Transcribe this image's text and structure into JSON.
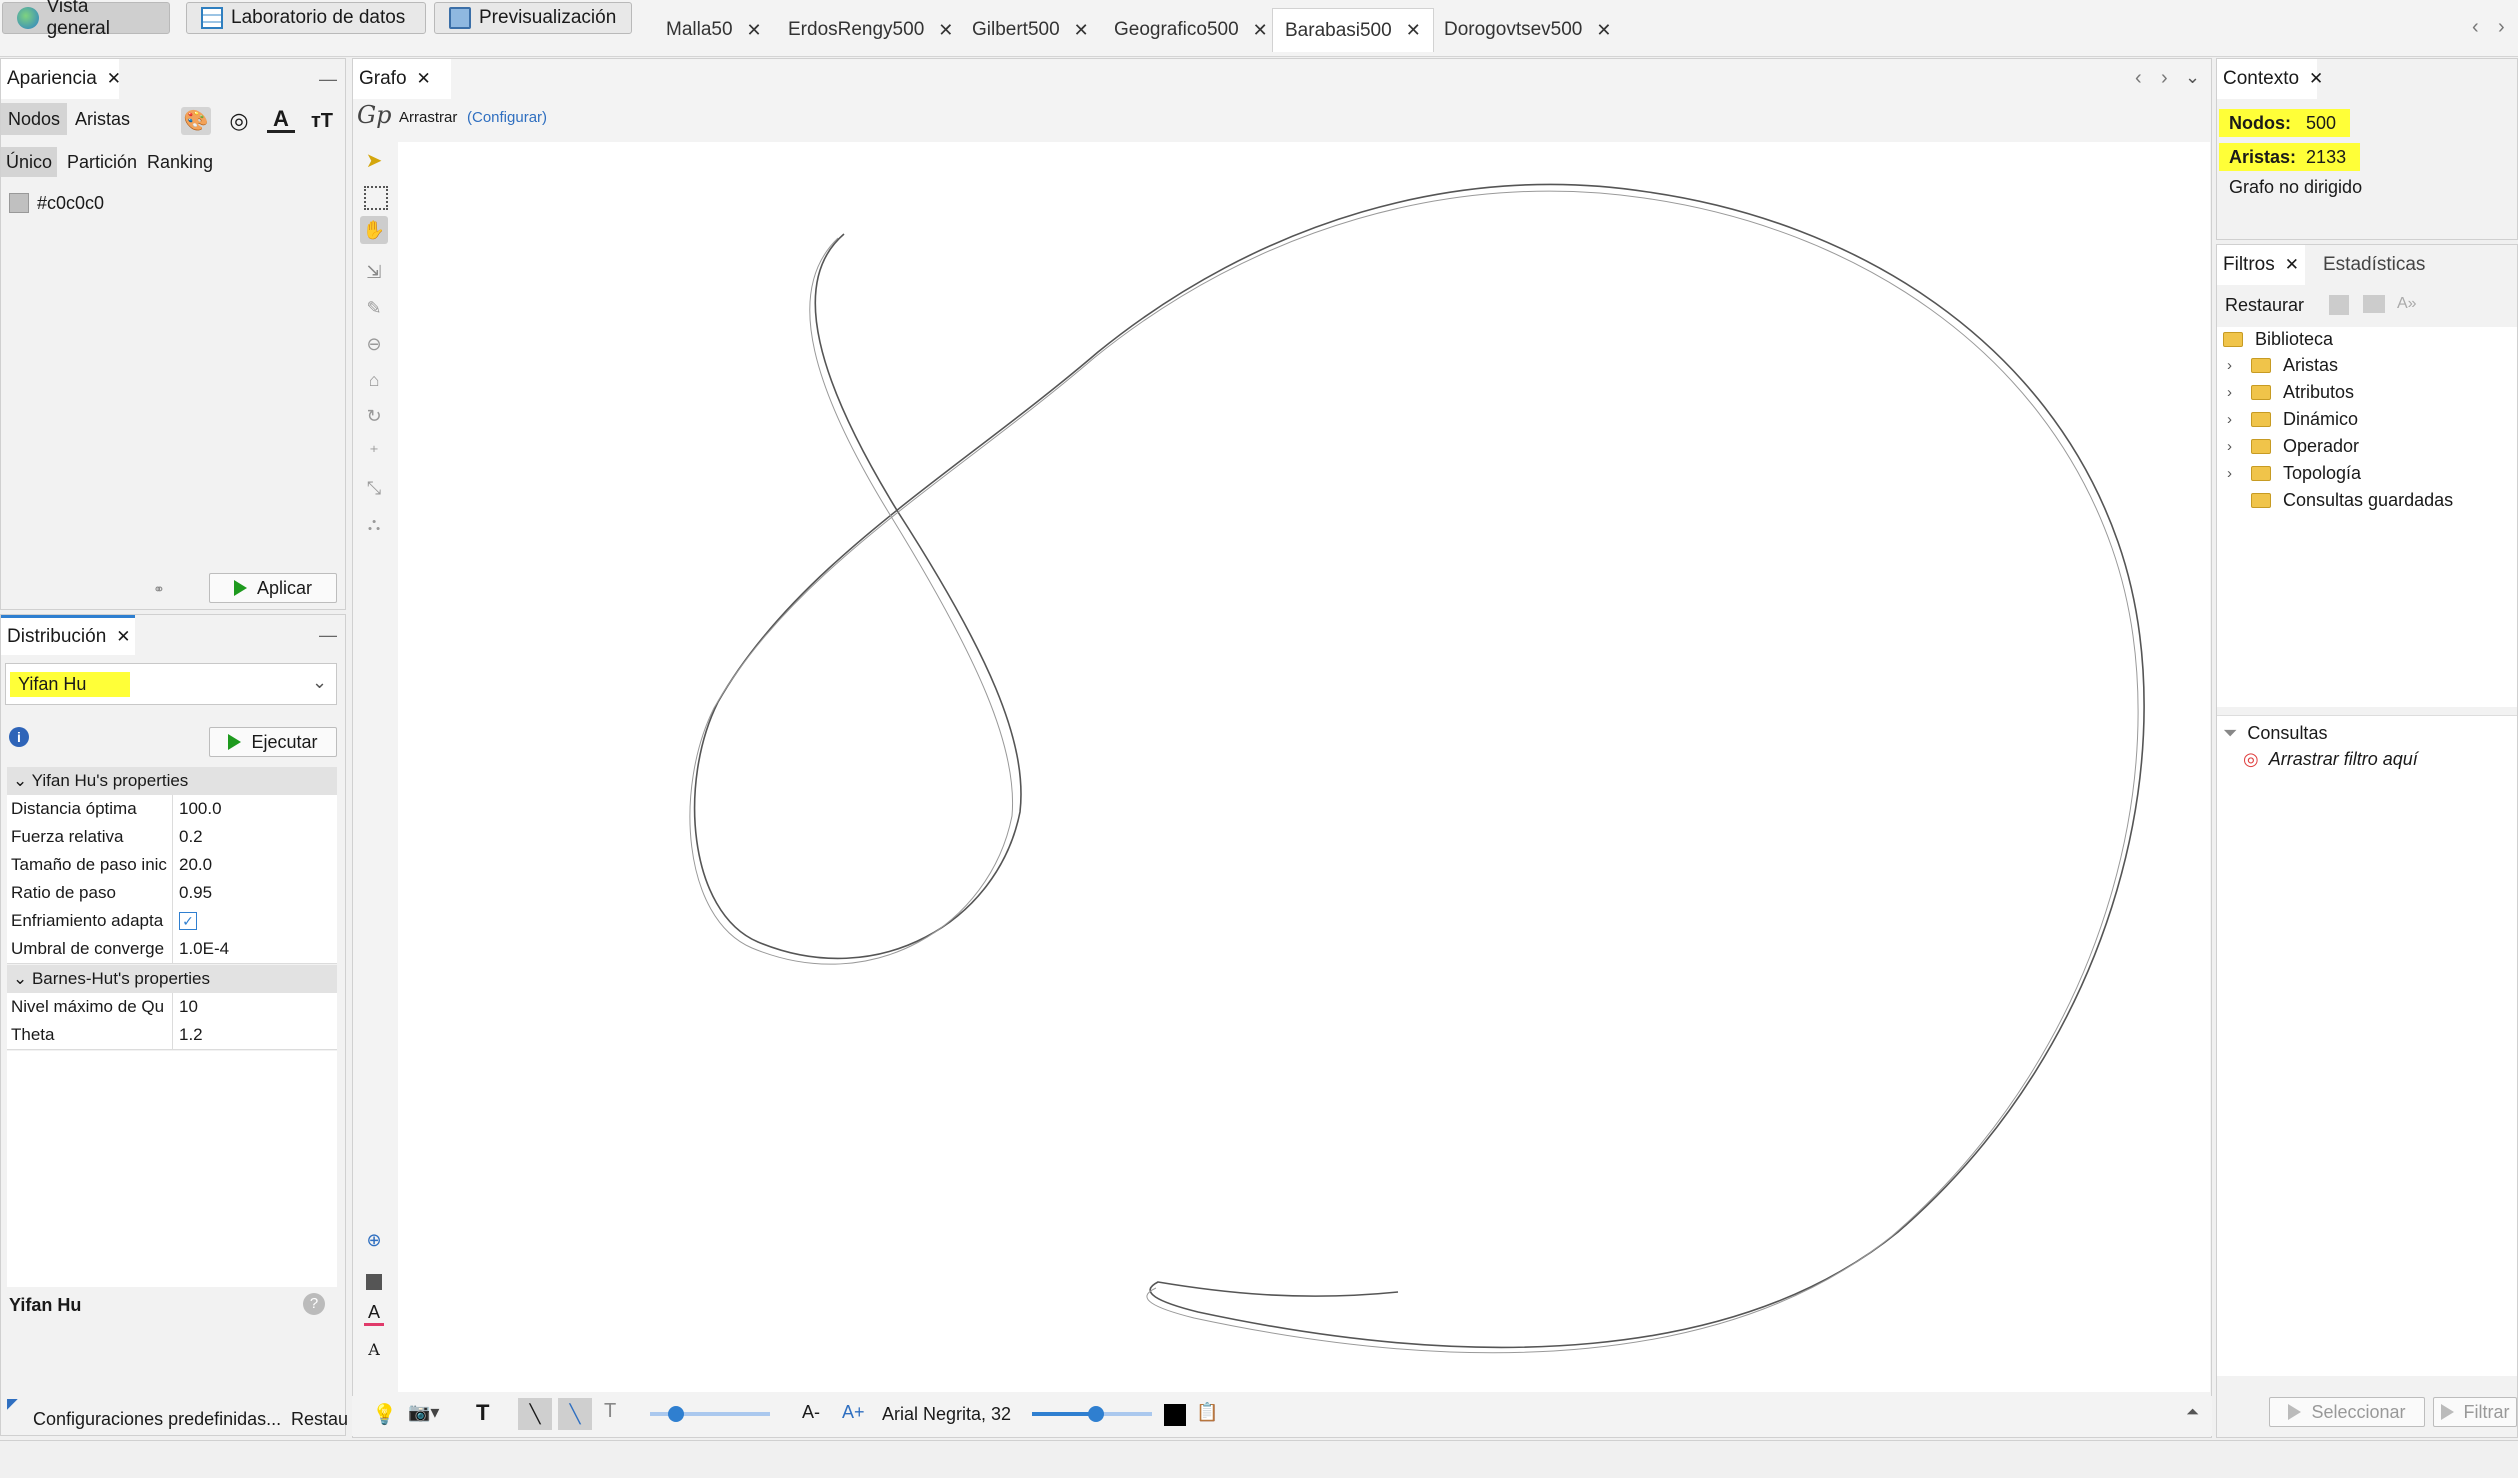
{
  "toolbar": {
    "overview": "Vista general",
    "data_lab": "Laboratorio de datos",
    "preview": "Previsualización"
  },
  "doc_tabs": [
    "Malla50",
    "ErdosRengy500",
    "Gilbert500",
    "Geografico500",
    "Barabasi500",
    "Dorogovtsev500"
  ],
  "active_doc_tab": "Barabasi500",
  "appearance": {
    "title": "Apariencia",
    "tab_nodes": "Nodos",
    "tab_edges": "Aristas",
    "sub_unique": "Único",
    "sub_partition": "Partición",
    "sub_ranking": "Ranking",
    "color_value": "#c0c0c0",
    "apply": "Aplicar"
  },
  "layout": {
    "title": "Distribución",
    "algorithm": "Yifan Hu",
    "run": "Ejecutar",
    "section1": "Yifan Hu's properties",
    "props1": [
      {
        "k": "Distancia óptima",
        "v": "100.0"
      },
      {
        "k": "Fuerza relativa",
        "v": "0.2"
      },
      {
        "k": "Tamaño de paso inic",
        "v": "20.0"
      },
      {
        "k": "Ratio de paso",
        "v": "0.95"
      },
      {
        "k": "Enfriamiento adapta",
        "v": ""
      },
      {
        "k": "Umbral de converge",
        "v": "1.0E-4"
      }
    ],
    "section2": "Barnes-Hut's properties",
    "props2": [
      {
        "k": "Nivel máximo de Qu",
        "v": "10"
      },
      {
        "k": "Theta",
        "v": "1.2"
      }
    ],
    "description_title": "Yifan Hu",
    "presets": "Configuraciones predefinidas...",
    "reset": "Restau"
  },
  "graph": {
    "title": "Grafo",
    "mode": "Arrastrar",
    "configure": "(Configurar)",
    "font_label": "Arial Negrita, 32"
  },
  "context": {
    "title": "Contexto",
    "nodes_label": "Nodos:",
    "nodes_value": "500",
    "edges_label": "Aristas:",
    "edges_value": "2133",
    "graph_type": "Grafo no dirigido"
  },
  "filters": {
    "tab_filters": "Filtros",
    "tab_stats": "Estadísticas",
    "reset": "Restaurar",
    "library": "Biblioteca",
    "items": [
      "Aristas",
      "Atributos",
      "Dinámico",
      "Operador",
      "Topología",
      "Consultas guardadas"
    ],
    "queries": "Consultas",
    "drop_here": "Arrastrar filtro aquí",
    "select": "Seleccionar",
    "filter": "Filtrar"
  }
}
